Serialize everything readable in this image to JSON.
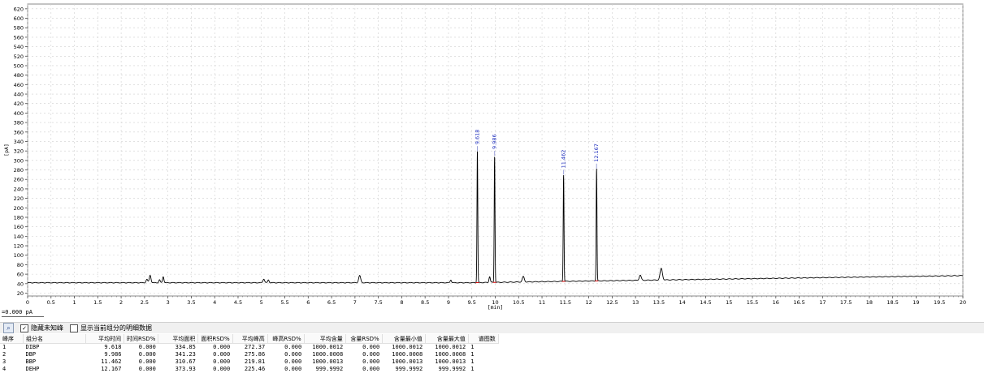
{
  "chart_data": {
    "type": "line",
    "xlabel": "[min]",
    "ylabel": "[pA]",
    "xlim": [
      0,
      20
    ],
    "ylim": [
      14,
      630
    ],
    "x_ticks": [
      "0",
      "0.5",
      "1",
      "1.5",
      "2",
      "2.5",
      "3",
      "3.5",
      "4",
      "4.5",
      "5",
      "5.5",
      "6",
      "6.5",
      "7",
      "7.5",
      "8",
      "8.5",
      "9",
      "9.5",
      "10",
      "10.5",
      "11",
      "11.5",
      "12",
      "12.5",
      "13",
      "13.5",
      "14",
      "14.5",
      "15",
      "15.5",
      "16",
      "16.5",
      "17",
      "17.5",
      "18",
      "18.5",
      "19",
      "19.5",
      "20"
    ],
    "y_ticks": [
      "20",
      "40",
      "60",
      "80",
      "100",
      "120",
      "140",
      "160",
      "180",
      "200",
      "220",
      "240",
      "260",
      "280",
      "300",
      "320",
      "340",
      "360",
      "380",
      "400",
      "420",
      "440",
      "460",
      "480",
      "500",
      "520",
      "540",
      "560",
      "580",
      "600",
      "620"
    ],
    "grid": true,
    "baseline": {
      "start": 42,
      "end": 57
    },
    "peaks": [
      {
        "rt": 2.55,
        "height": 49,
        "width": 0.025
      },
      {
        "rt": 2.62,
        "height": 58,
        "width": 0.025
      },
      {
        "rt": 2.82,
        "height": 48,
        "width": 0.02
      },
      {
        "rt": 2.9,
        "height": 55,
        "width": 0.02
      },
      {
        "rt": 5.05,
        "height": 50,
        "width": 0.025
      },
      {
        "rt": 5.15,
        "height": 48,
        "width": 0.02
      },
      {
        "rt": 7.1,
        "height": 57,
        "width": 0.03
      },
      {
        "rt": 9.05,
        "height": 48,
        "width": 0.02
      },
      {
        "rt": 9.618,
        "height": 320,
        "width": 0.012,
        "label": "9.618"
      },
      {
        "rt": 9.88,
        "height": 55,
        "width": 0.02
      },
      {
        "rt": 9.986,
        "height": 310,
        "width": 0.012,
        "label": "9.986"
      },
      {
        "rt": 10.6,
        "height": 55,
        "width": 0.03
      },
      {
        "rt": 11.462,
        "height": 270,
        "width": 0.012,
        "label": "11.462"
      },
      {
        "rt": 12.167,
        "height": 283,
        "width": 0.012,
        "label": "12.167"
      },
      {
        "rt": 13.1,
        "height": 58,
        "width": 0.03
      },
      {
        "rt": 13.55,
        "height": 72,
        "width": 0.035
      }
    ]
  },
  "baseline_readout": "=0.000 pA",
  "toolbar": {
    "hide_unknown_label": "隐藏未知峰",
    "hide_unknown_checked": true,
    "show_details_label": "显示当前组分的明细数据",
    "show_details_checked": false
  },
  "table": {
    "headers": [
      "峰序",
      "组分名",
      "平均时间",
      "时间RSD%",
      "平均面积",
      "面积RSD%",
      "平均峰高",
      "峰高RSD%",
      "平均含量",
      "含量RSD%",
      "含量最小值",
      "含量最大值",
      "谱图数"
    ],
    "rows": [
      [
        "1",
        "DIBP",
        "9.618",
        "0.000",
        "334.85",
        "0.000",
        "272.37",
        "0.000",
        "1000.0012",
        "0.000",
        "1000.0012",
        "1000.0012",
        "1"
      ],
      [
        "2",
        "DBP",
        "9.986",
        "0.000",
        "341.23",
        "0.000",
        "275.86",
        "0.000",
        "1000.0008",
        "0.000",
        "1000.0008",
        "1000.0008",
        "1"
      ],
      [
        "3",
        "BBP",
        "11.462",
        "0.000",
        "310.67",
        "0.000",
        "219.81",
        "0.000",
        "1000.0013",
        "0.000",
        "1000.0013",
        "1000.0013",
        "1"
      ],
      [
        "4",
        "DEHP",
        "12.167",
        "0.000",
        "373.93",
        "0.000",
        "225.46",
        "0.000",
        "999.9992",
        "0.000",
        "999.9992",
        "999.9992",
        "1"
      ]
    ]
  }
}
